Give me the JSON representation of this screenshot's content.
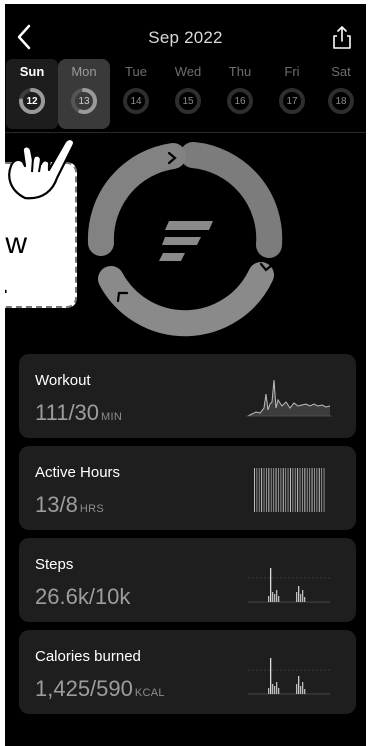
{
  "header": {
    "title": "Sep 2022",
    "back_icon": "chevron-left-icon",
    "share_icon": "share-icon"
  },
  "days": [
    {
      "label": "Sun",
      "num": "12",
      "state": "selected",
      "progress": 0.75
    },
    {
      "label": "Mon",
      "num": "13",
      "state": "highlighted",
      "progress": 0.55
    },
    {
      "label": "Tue",
      "num": "14",
      "state": "future",
      "progress": 0
    },
    {
      "label": "Wed",
      "num": "15",
      "state": "future",
      "progress": 0
    },
    {
      "label": "Thu",
      "num": "16",
      "state": "future",
      "progress": 0
    },
    {
      "label": "Fri",
      "num": "17",
      "state": "future",
      "progress": 0
    },
    {
      "label": "Sat",
      "num": "18",
      "state": "future",
      "progress": 0
    }
  ],
  "tooltip": {
    "line1": "view",
    "line2": "."
  },
  "cards": [
    {
      "name": "Workout",
      "value": "111/30",
      "unit": "MIN",
      "chart": "area"
    },
    {
      "name": "Active Hours",
      "value": "13/8",
      "unit": "HRS",
      "chart": "bars-dense"
    },
    {
      "name": "Steps",
      "value": "26.6k/10k",
      "unit": "",
      "chart": "bars-sparse"
    },
    {
      "name": "Calories burned",
      "value": "1,425/590",
      "unit": "KCAL",
      "chart": "bars-sparse"
    }
  ],
  "colors": {
    "background": "#000000",
    "card": "#1e1e1e",
    "ring": "#8a8a8a",
    "value_text": "#9d9d9d"
  }
}
